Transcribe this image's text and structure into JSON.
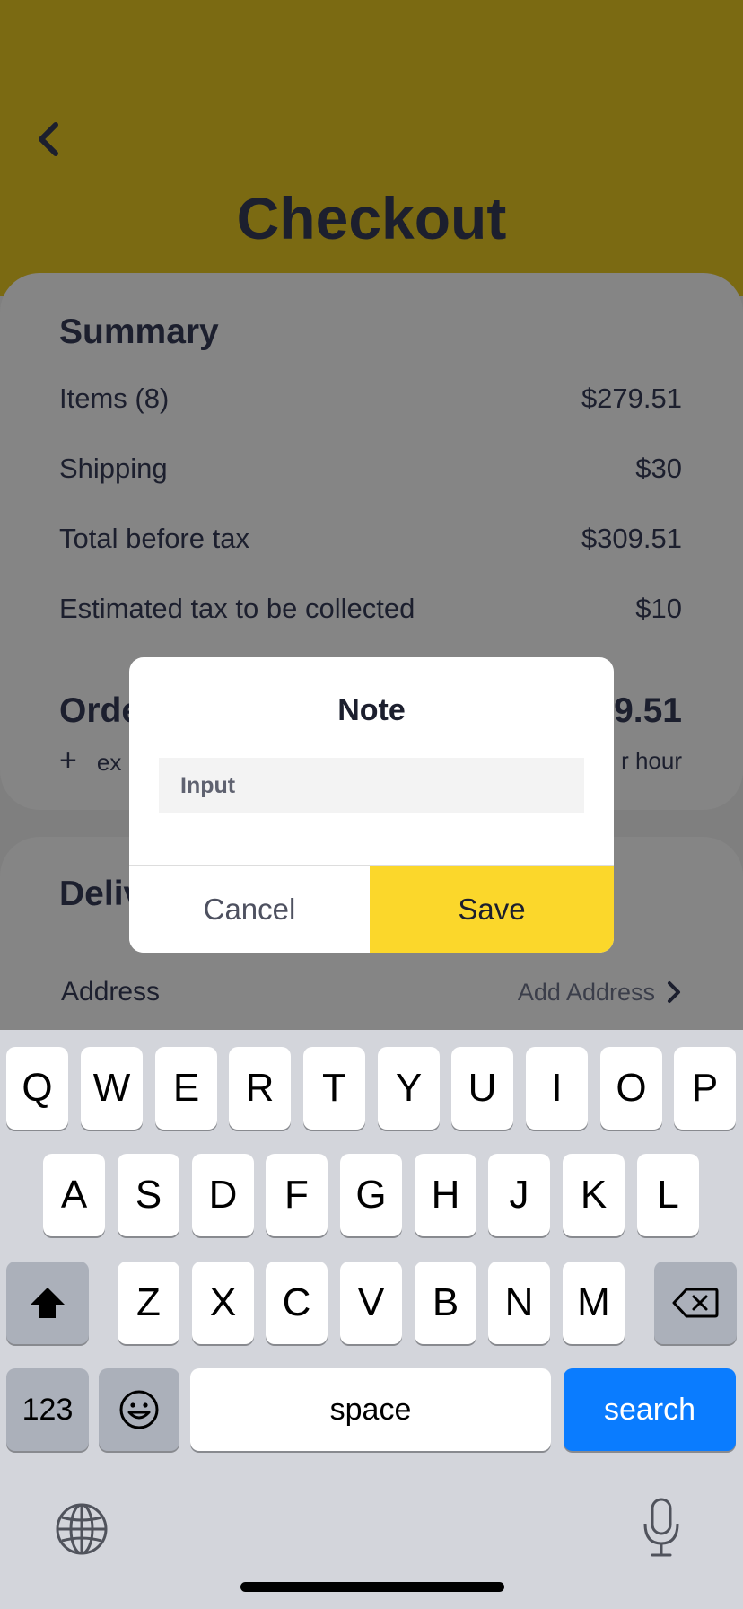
{
  "header": {
    "title": "Checkout",
    "back_icon": "chevron-left-icon",
    "color": "#7b6a12"
  },
  "summary": {
    "title": "Summary",
    "rows": [
      {
        "label": "Items (8)",
        "value": "$279.51"
      },
      {
        "label": "Shipping",
        "value": "$30"
      },
      {
        "label": "Total before tax",
        "value": "$309.51"
      },
      {
        "label": "Estimated tax to be collected",
        "value": "$10"
      }
    ],
    "order_total": {
      "label": "Orde",
      "value": "9.51"
    },
    "extra": {
      "icon": "+",
      "label": "ex",
      "value": "r hour"
    }
  },
  "delivery": {
    "title": "Deliv",
    "address_label": "Address",
    "address_action": "Add Address",
    "address_icon": "chevron-right-icon"
  },
  "dialog": {
    "title": "Note",
    "input_placeholder": "Input",
    "input_value": "",
    "cancel_label": "Cancel",
    "save_label": "Save",
    "save_color": "#fbd72b"
  },
  "keyboard": {
    "row1": [
      "Q",
      "W",
      "E",
      "R",
      "T",
      "Y",
      "U",
      "I",
      "O",
      "P"
    ],
    "row2": [
      "A",
      "S",
      "D",
      "F",
      "G",
      "H",
      "J",
      "K",
      "L"
    ],
    "row3": [
      "Z",
      "X",
      "C",
      "V",
      "B",
      "N",
      "M"
    ],
    "numbers_label": "123",
    "space_label": "space",
    "search_label": "search",
    "search_color": "#0a7cff",
    "icons": [
      "shift-icon",
      "backspace-icon",
      "emoji-icon",
      "globe-icon",
      "microphone-icon"
    ]
  }
}
